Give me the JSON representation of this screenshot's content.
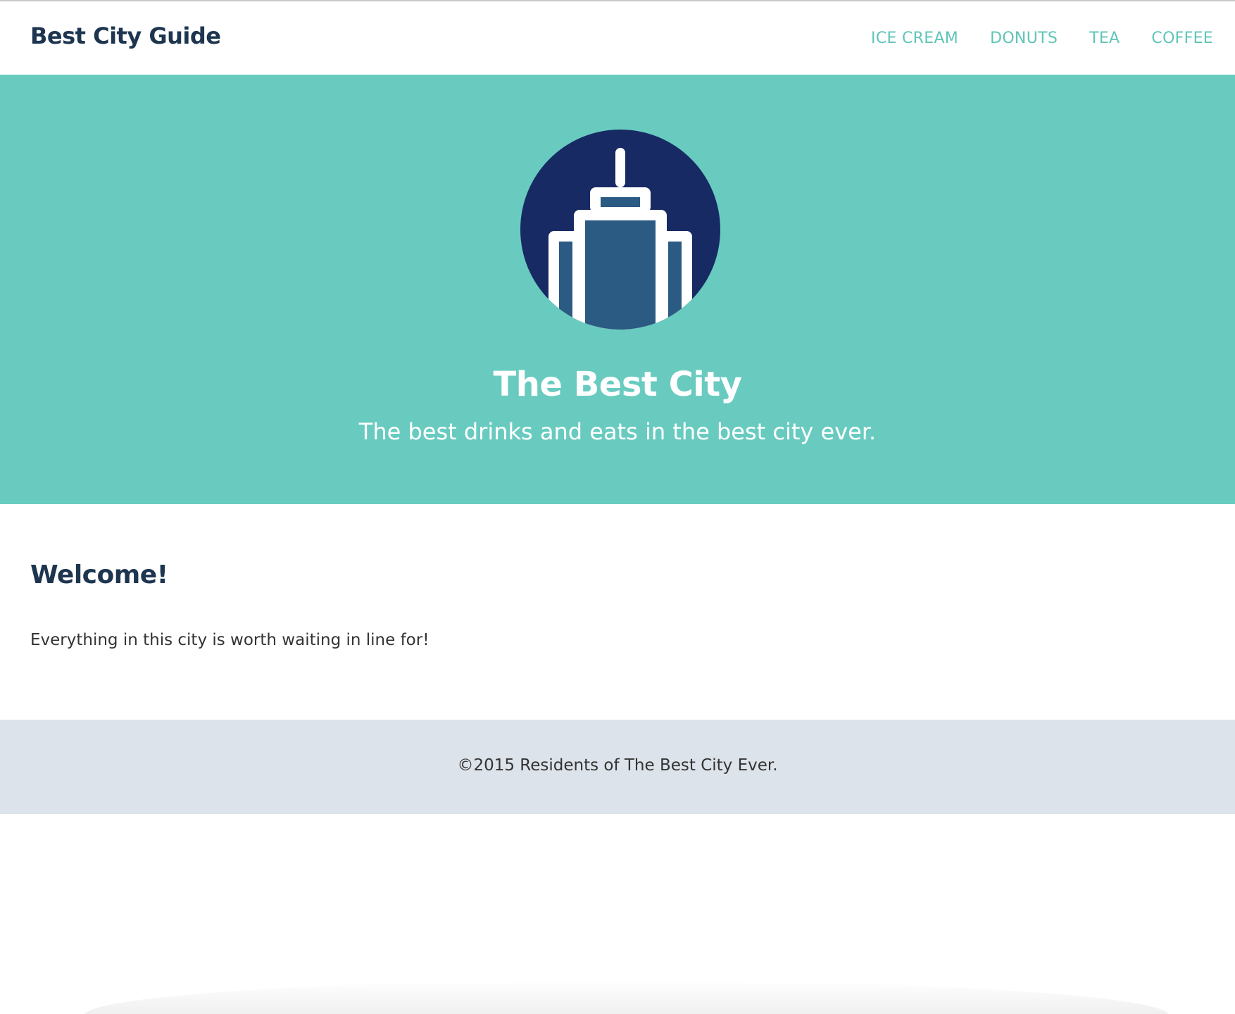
{
  "colors": {
    "brand_text": "#1e3550",
    "nav_link": "#5fc5b8",
    "hero_bg": "#69cbc0",
    "icon_circle": "#172a63",
    "icon_building_fill": "#2b5a82",
    "icon_outline": "#ffffff",
    "footer_bg": "#dde3ea",
    "heading": "#1e3550"
  },
  "header": {
    "brand": "Best City Guide",
    "nav": [
      {
        "label": "ICE CREAM"
      },
      {
        "label": "DONUTS"
      },
      {
        "label": "TEA"
      },
      {
        "label": "COFFEE"
      }
    ]
  },
  "hero": {
    "icon": "skyscraper-icon",
    "title": "The Best City",
    "subtitle": "The best drinks and eats in the best city ever."
  },
  "main": {
    "heading": "Welcome!",
    "text": "Everything in this city is worth waiting in line for!"
  },
  "footer": {
    "text": "©2015 Residents of The Best City Ever."
  }
}
